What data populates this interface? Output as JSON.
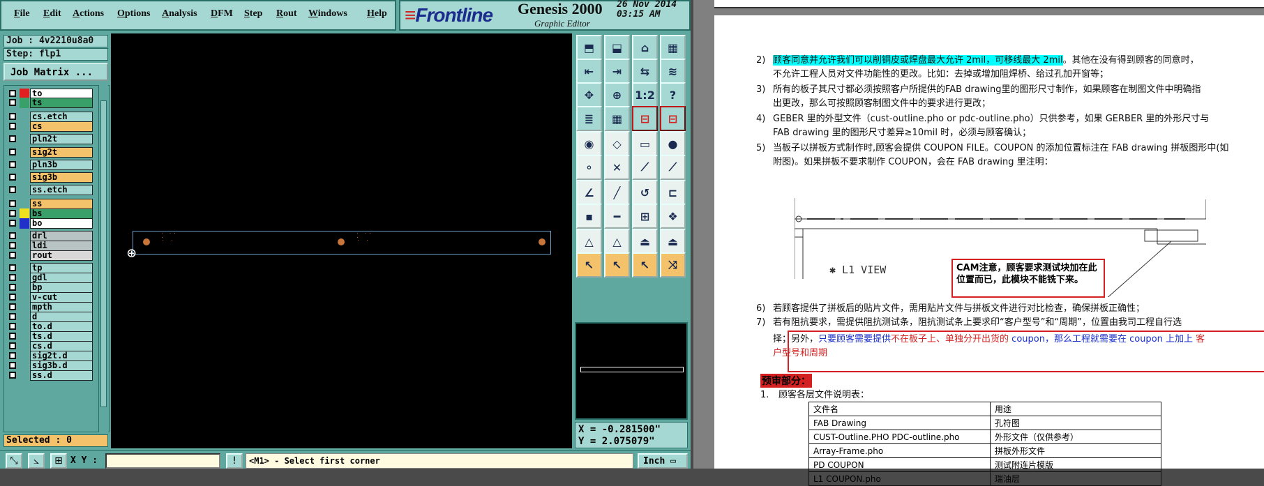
{
  "menu": [
    "File",
    "Edit",
    "Actions",
    "Options",
    "Analysis",
    "DFM",
    "Step",
    "Rout",
    "Windows",
    "Help"
  ],
  "brand": {
    "logo": "Frontline",
    "app": "Genesis 2000",
    "subtitle": "Graphic Editor",
    "date": "26 Nov 2014",
    "time": "03:15 AM"
  },
  "job": {
    "job_label": "Job : 4v2210u8a0",
    "step_label": "Step: flp1",
    "matrix_button": "Job Matrix ..."
  },
  "layers": [
    {
      "name": "to",
      "color": "#ffffff",
      "swatch": "#e02020"
    },
    {
      "name": "ts",
      "color": "#3aa06a",
      "swatch": "#3aa06a"
    },
    {
      "name": "cs.etch",
      "color": "#a5d8d2",
      "swatch": "#5fa8a0"
    },
    {
      "name": "cs",
      "color": "#f3c26a",
      "swatch": "#5fa8a0"
    },
    {
      "name": "pln2t",
      "color": "#a5d8d2",
      "swatch": "#5fa8a0"
    },
    {
      "name": "sig2t",
      "color": "#f3c26a",
      "swatch": "#5fa8a0"
    },
    {
      "name": "pln3b",
      "color": "#a5d8d2",
      "swatch": "#5fa8a0"
    },
    {
      "name": "sig3b",
      "color": "#f3c26a",
      "swatch": "#5fa8a0"
    },
    {
      "name": "ss.etch",
      "color": "#a5d8d2",
      "swatch": "#5fa8a0"
    },
    {
      "name": "ss",
      "color": "#f3c26a",
      "swatch": "#5fa8a0"
    },
    {
      "name": "bs",
      "color": "#3aa06a",
      "swatch": "#f0e020"
    },
    {
      "name": "bo",
      "color": "#ffffff",
      "swatch": "#2030c8"
    },
    {
      "name": "drl",
      "color": "#b8c4c4",
      "swatch": "#5fa8a0"
    },
    {
      "name": "ldi",
      "color": "#b8c4c4",
      "swatch": "#5fa8a0"
    },
    {
      "name": "rout",
      "color": "#d8d8d8",
      "swatch": "#5fa8a0"
    },
    {
      "name": "tp",
      "color": "#a5d8d2",
      "swatch": "#5fa8a0"
    },
    {
      "name": "gdl",
      "color": "#a5d8d2",
      "swatch": "#5fa8a0"
    },
    {
      "name": "bp",
      "color": "#a5d8d2",
      "swatch": "#5fa8a0"
    },
    {
      "name": "v-cut",
      "color": "#a5d8d2",
      "swatch": "#5fa8a0"
    },
    {
      "name": "mpth",
      "color": "#a5d8d2",
      "swatch": "#5fa8a0"
    },
    {
      "name": "d",
      "color": "#a5d8d2",
      "swatch": "#5fa8a0"
    },
    {
      "name": "to.d",
      "color": "#a5d8d2",
      "swatch": "#5fa8a0"
    },
    {
      "name": "ts.d",
      "color": "#a5d8d2",
      "swatch": "#5fa8a0"
    },
    {
      "name": "cs.d",
      "color": "#a5d8d2",
      "swatch": "#5fa8a0"
    },
    {
      "name": "sig2t.d",
      "color": "#a5d8d2",
      "swatch": "#5fa8a0"
    },
    {
      "name": "sig3b.d",
      "color": "#a5d8d2",
      "swatch": "#5fa8a0"
    },
    {
      "name": "ss.d",
      "color": "#a5d8d2",
      "swatch": "#5fa8a0"
    }
  ],
  "selected_label": "Selected : 0",
  "coords": {
    "x": "X = -0.281500\"",
    "y": "Y = 2.075079\""
  },
  "status": {
    "xy_label": "X Y :",
    "message": "<M1> - Select first corner",
    "unit": "Inch"
  },
  "doc": {
    "item2_hl": "顾客同意并允许我们可以削铜皮或焊盘最大允许 2mil，可移线最大 2mil",
    "item2_rest": "。其他在没有得到顾客的同意时，",
    "item2_l2": "不允许工程人员对文件功能性的更改。比如：去掉或增加阻焊桥、给过孔加开窗等；",
    "item3_l1": "所有的板子其尺寸都必须按照客户所提供的FAB drawing里的图形尺寸制作，如果顾客在制图文件中明确指",
    "item3_l2": "出更改，那么可按照顾客制图文件中的要求进行更改；",
    "item4_l1": "GEBER 里的外型文件（cust-outline.pho or pdc-outline.pho）只供参考，如果 GERBER 里的外形尺寸与",
    "item4_l2": "FAB drawing 里的图形尺寸差异≥10mil 时，必须与顾客确认；",
    "item5_l1": "当板子以拼板方式制作时,顾客会提供 COUPON FILE。COUPON 的添加位置标注在 FAB drawing 拼板图形中(如",
    "item5_l2": "附图)。如果拼板不要求制作 COUPON，会在 FAB drawing 里注明：",
    "fig_label": "✱ L1 VIEW",
    "callout": "CAM注意，顾客要求测试块加在此位置而已，此模块不能铣下来。",
    "item6": "若顾客提供了拼板后的贴片文件，需用贴片文件与拼板文件进行对比检查，确保拼板正确性；",
    "item7_l1": "若有阻抗要求，需提供阻抗测试条，阻抗测试条上要求印“客户型号”和“周期”，位置由我司工程自行选",
    "item7_l2a": "择；另外，",
    "item7_l2b": "只要顾客需要提供",
    "item7_l2c": "不在板子上、单独分开出货的",
    "item7_l2d": " coupon，那么工程就需要在 coupon 上加上 ",
    "item7_l2e": "客",
    "item7_l3": "户型号和周期",
    "section": "预审部分：",
    "list1": "顾客各层文件说明表：",
    "nums": [
      "2)",
      "3)",
      "4)",
      "5)",
      "6)",
      "7)",
      "1."
    ],
    "table": [
      [
        "文件名",
        "用途"
      ],
      [
        "FAB Drawing",
        "孔符图"
      ],
      [
        "CUST-Outline.PHO    PDC-outline.pho",
        "外形文件（仅供参考）"
      ],
      [
        "Array-Frame.pho",
        "拼板外形文件"
      ],
      [
        "PD COUPON",
        "测试附连片模版"
      ],
      [
        "L1 COUPON.pho",
        "瑞油层"
      ]
    ]
  }
}
